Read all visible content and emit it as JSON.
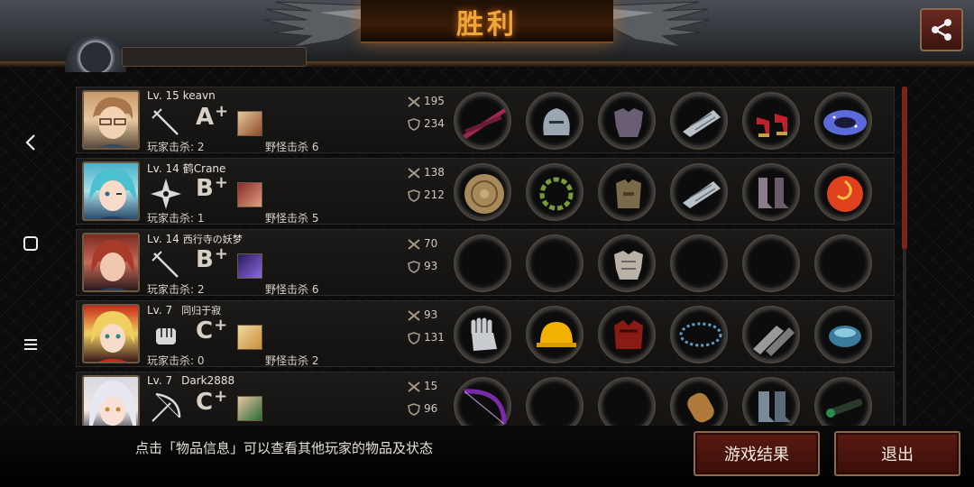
{
  "title": "胜利",
  "hint": "点击「物品信息」可以查看其他玩家的物品及状态",
  "buttons": {
    "result": "游戏结果",
    "exit": "退出"
  },
  "icons": {
    "share": "share-icon",
    "back": "back-icon",
    "home": "home-icon",
    "menu": "menu-icon"
  },
  "labels": {
    "pk": "玩家击杀",
    "mk": "野怪击杀"
  },
  "players": [
    {
      "level": "Lv. 15",
      "name": "keavn",
      "weapon": "rapier-icon",
      "grade": "A",
      "grade_mod": "+",
      "player_kills": "玩家击杀: 2",
      "monster_kills": "野怪击杀 6",
      "attack": "195",
      "defense": "234",
      "items": [
        "dual-blade-icon",
        "knight-helmet-icon",
        "plate-armor-icon",
        "steel-gauntlet-icon",
        "red-heels-icon",
        "galaxy-ring-icon"
      ],
      "item_colors": [
        "#a0284a",
        "#9aa6b2",
        "#6a5e74",
        "#b8c0c8",
        "#c0202a",
        "#5a6ad8"
      ]
    },
    {
      "level": "Lv. 14",
      "name": "鹤Crane",
      "weapon": "shuriken-icon",
      "grade": "B",
      "grade_mod": "+",
      "player_kills": "玩家击杀: 1",
      "monster_kills": "野怪击杀 5",
      "attack": "138",
      "defense": "212",
      "items": [
        "bronze-shield-icon",
        "laurel-wreath-icon",
        "leather-armor-icon",
        "steel-gauntlet-icon",
        "leather-boots-icon",
        "fire-orb-icon"
      ],
      "item_colors": [
        "#a88a5a",
        "#7a9a3a",
        "#7a6a4a",
        "#b8c0c8",
        "#8a7a8a",
        "#e0401e"
      ]
    },
    {
      "level": "Lv. 14",
      "name": "西行寺の妖梦",
      "weapon": "rapier-icon",
      "grade": "B",
      "grade_mod": "+",
      "player_kills": "玩家击杀: 2",
      "monster_kills": "野怪击杀 6",
      "attack": "70",
      "defense": "93",
      "items": [
        "",
        "",
        "plate-armor-icon",
        "",
        "",
        ""
      ],
      "item_colors": [
        "",
        "",
        "#b8b2a6",
        "",
        "",
        ""
      ]
    },
    {
      "level": "Lv. 7",
      "name": "同归于寂",
      "weapon": "fist-icon",
      "grade": "C",
      "grade_mod": "+",
      "player_kills": "玩家击杀: 0",
      "monster_kills": "野怪击杀 2",
      "attack": "93",
      "defense": "131",
      "items": [
        "metal-gauntlet-icon",
        "hard-hat-icon",
        "crimson-armor-icon",
        "bead-necklace-icon",
        "chain-gloves-icon",
        "crystal-bowl-icon"
      ],
      "item_colors": [
        "#c8ccd0",
        "#f2b000",
        "#8a1a14",
        "#5aa0c8",
        "#9a9a9a",
        "#3a7a9a"
      ]
    },
    {
      "level": "Lv. 7",
      "name": "Dark2888",
      "weapon": "bow-icon",
      "grade": "C",
      "grade_mod": "+",
      "player_kills": "",
      "monster_kills": "",
      "attack": "15",
      "defense": "96",
      "items": [
        "purple-bow-icon",
        "",
        "",
        "bracer-icon",
        "armored-boots-icon",
        "scope-icon"
      ],
      "item_colors": [
        "#7a2aa8",
        "",
        "",
        "#b07a3a",
        "#7a8a9a",
        "#2a8a4a"
      ]
    }
  ],
  "colors": {
    "accent_title": "#f0a53a",
    "button_red": "#5a1a12",
    "scroll": "#7a2418"
  }
}
